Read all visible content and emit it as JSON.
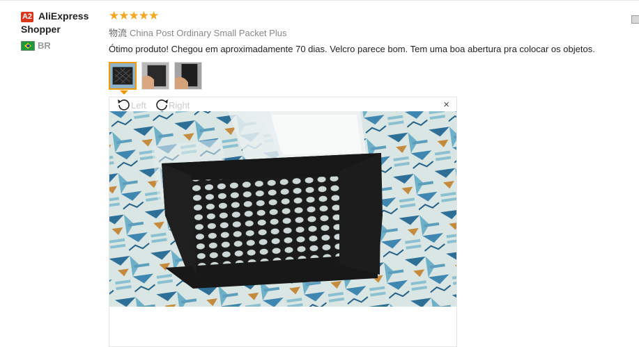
{
  "reviewer": {
    "level_badge": "A2",
    "name": "AliExpress Shopper",
    "country_code": "BR"
  },
  "rating": {
    "stars": 5,
    "stars_text": "★★★★★"
  },
  "shipping": {
    "label": "物流",
    "method": "China Post Ordinary Small Packet Plus"
  },
  "review_text": "Ótimo produto! Chegou em aproximadamente 70 dias. Velcro parece bom. Tem uma boa abertura pra colocar os objetos.",
  "photos": {
    "thumbnails": [
      "photo-1",
      "photo-2",
      "photo-3"
    ],
    "selected_index": 0
  },
  "viewer": {
    "rotate_left_label": "Left",
    "rotate_right_label": "Right",
    "close_glyph": "×"
  },
  "colors": {
    "badge": "#d9361b",
    "stars": "#f5a623",
    "selected_thumb_border": "#f39800"
  },
  "icons": [
    "rotate-left-icon",
    "rotate-right-icon",
    "close-icon",
    "brazil-flag-icon"
  ]
}
